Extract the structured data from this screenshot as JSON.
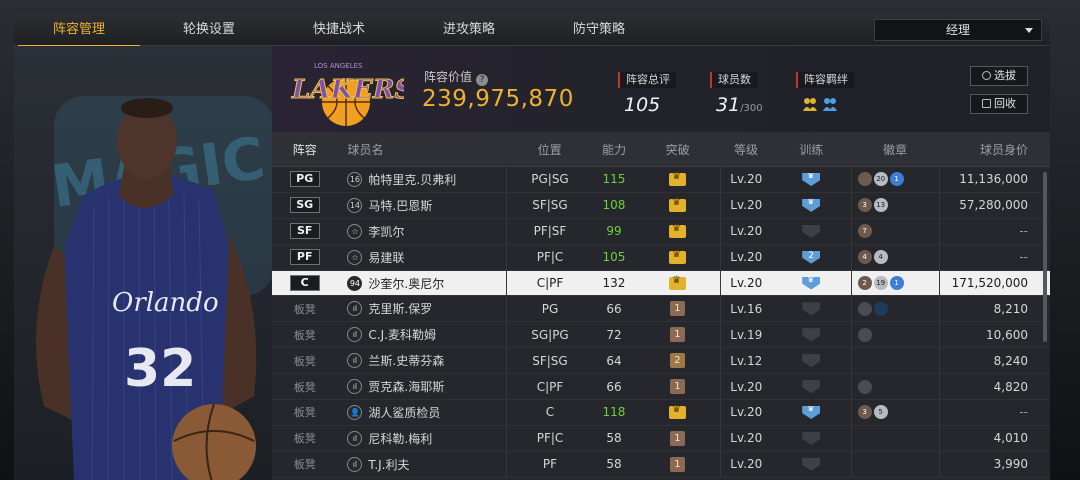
{
  "nav": {
    "tabs": [
      "阵容管理",
      "轮换设置",
      "快捷战术",
      "进攻策略",
      "防守策略"
    ],
    "active": 0,
    "role_select": "经理"
  },
  "summary": {
    "value_label": "阵容价值",
    "value": "239,975,870",
    "rating_label": "阵容总评",
    "rating": "105",
    "count_label": "球员数",
    "count": "31",
    "count_max": "/300",
    "bond_label": "阵容羁绊",
    "btn_select": "选拔",
    "btn_recycle": "回收"
  },
  "logo": {
    "team": "LAKERS",
    "arc": "LOS ANGELES"
  },
  "art": {
    "jersey_text": "Orlando",
    "jersey_number": "32",
    "wall_text": "MAGIC"
  },
  "table": {
    "headers": [
      "阵容",
      "球员名",
      "位置",
      "能力",
      "突破",
      "等级",
      "训练",
      "徽章",
      "球员身价"
    ],
    "rows": [
      {
        "slot": "PG",
        "starter": true,
        "num": "16",
        "name": "帕特里克.贝弗利",
        "pos": "PG|SG",
        "ovr": "115",
        "ovr_green": true,
        "brk": "crown",
        "lvl": "Lv.20",
        "train": "blue",
        "badges": [
          "br",
          "sv:20",
          "bl:1"
        ],
        "val": "11,136,000"
      },
      {
        "slot": "SG",
        "starter": true,
        "num": "14",
        "name": "马特.巴恩斯",
        "pos": "SF|SG",
        "ovr": "108",
        "ovr_green": true,
        "brk": "crown",
        "lvl": "Lv.20",
        "train": "blue",
        "badges": [
          "br:3",
          "sv:13"
        ],
        "val": "57,280,000"
      },
      {
        "slot": "SF",
        "starter": true,
        "num": "☆",
        "name": "李凯尔",
        "pos": "PF|SF",
        "ovr": "99",
        "ovr_green": true,
        "brk": "crown",
        "lvl": "Lv.20",
        "train": "dark",
        "badges": [
          "br:7"
        ],
        "val": "--"
      },
      {
        "slot": "PF",
        "starter": true,
        "num": "☆",
        "name": "易建联",
        "pos": "PF|C",
        "ovr": "105",
        "ovr_green": true,
        "brk": "crown",
        "lvl": "Lv.20",
        "train": "blue2",
        "badges": [
          "br:4",
          "sv:4"
        ],
        "val": "--"
      },
      {
        "slot": "C",
        "starter": true,
        "sel": true,
        "num": "94",
        "name": "沙奎尔.奥尼尔",
        "pos": "C|PF",
        "ovr": "132",
        "ovr_green": false,
        "brk": "crown",
        "lvl": "Lv.20",
        "train": "blue",
        "badges": [
          "br:2",
          "sv:19",
          "bl:1"
        ],
        "val": "171,520,000"
      },
      {
        "slot": "板凳",
        "starter": false,
        "num": "ıl",
        "name": "克里斯.保罗",
        "pos": "PG",
        "ovr": "66",
        "ovr_green": false,
        "brk": "lock1",
        "lvl": "Lv.16",
        "train": "dark",
        "badges": [
          "dk",
          "dkbl"
        ],
        "val": "8,210"
      },
      {
        "slot": "板凳",
        "starter": false,
        "num": "ıl",
        "name": "C.J.麦科勒姆",
        "pos": "SG|PG",
        "ovr": "72",
        "ovr_green": false,
        "brk": "lock1",
        "lvl": "Lv.19",
        "train": "dark",
        "badges": [
          "dk"
        ],
        "val": "10,600"
      },
      {
        "slot": "板凳",
        "starter": false,
        "num": "ıl",
        "name": "兰斯.史蒂芬森",
        "pos": "SF|SG",
        "ovr": "64",
        "ovr_green": false,
        "brk": "lock2",
        "lvl": "Lv.12",
        "train": "dark",
        "badges": [],
        "val": "8,240"
      },
      {
        "slot": "板凳",
        "starter": false,
        "num": "ıl",
        "name": "贾克森.海耶斯",
        "pos": "C|PF",
        "ovr": "66",
        "ovr_green": false,
        "brk": "lock1",
        "lvl": "Lv.20",
        "train": "dark",
        "badges": [
          "dk"
        ],
        "val": "4,820"
      },
      {
        "slot": "板凳",
        "starter": false,
        "num": "👤",
        "name": "湖人鲨质检员",
        "pos": "C",
        "ovr": "118",
        "ovr_green": true,
        "brk": "crown",
        "lvl": "Lv.20",
        "train": "blue",
        "badges": [
          "br:3",
          "sv:5"
        ],
        "val": "--"
      },
      {
        "slot": "板凳",
        "starter": false,
        "num": "ıl",
        "name": "尼科勒.梅利",
        "pos": "PF|C",
        "ovr": "58",
        "ovr_green": false,
        "brk": "lock1",
        "lvl": "Lv.20",
        "train": "dark",
        "badges": [],
        "val": "4,010"
      },
      {
        "slot": "板凳",
        "starter": false,
        "num": "ıl",
        "name": "T.J.利夫",
        "pos": "PF",
        "ovr": "58",
        "ovr_green": false,
        "brk": "lock1",
        "lvl": "Lv.20",
        "train": "dark",
        "badges": [],
        "val": "3,990"
      }
    ]
  }
}
